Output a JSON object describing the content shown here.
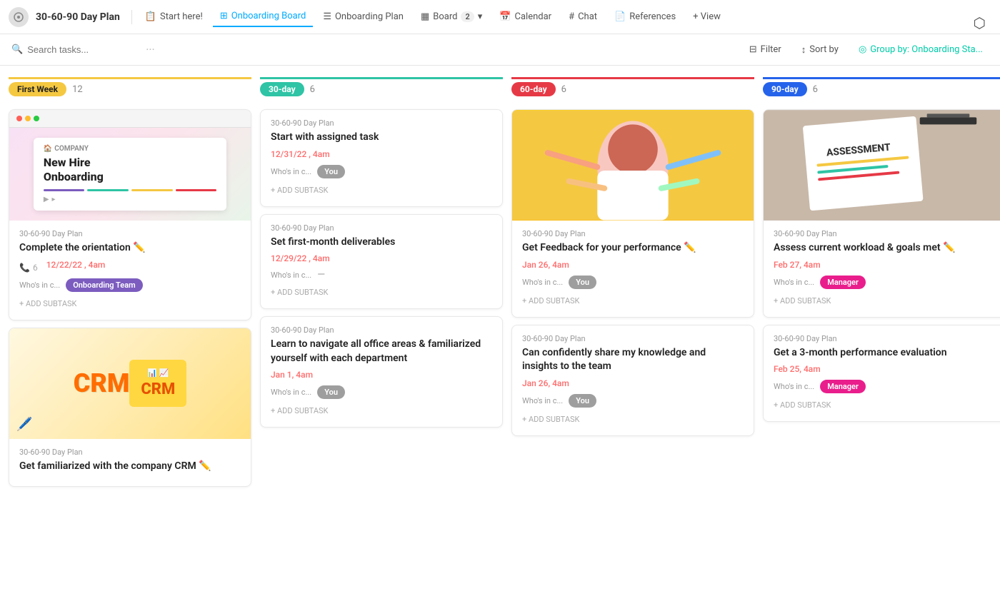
{
  "app": {
    "title": "30-60-90 Day Plan",
    "icon": "⚙"
  },
  "nav": {
    "start_here": "Start here!",
    "onboarding_board": "Onboarding Board",
    "onboarding_plan": "Onboarding Plan",
    "board": "Board",
    "board_count": "2",
    "calendar": "Calendar",
    "chat": "Chat",
    "references": "References",
    "plus_view": "+ View"
  },
  "toolbar": {
    "search_placeholder": "Search tasks...",
    "filter": "Filter",
    "sort_by": "Sort by",
    "group_by": "Group by: Onboarding Sta..."
  },
  "columns": [
    {
      "id": "first-week",
      "label": "First Week",
      "count": "12",
      "color": "#f5c842",
      "badge_class": "badge-first-week",
      "col_class": "col-first-week"
    },
    {
      "id": "30-day",
      "label": "30-day",
      "count": "6",
      "color": "#2ec4a5",
      "badge_class": "badge-30day",
      "col_class": "col-30day"
    },
    {
      "id": "60-day",
      "label": "60-day",
      "count": "6",
      "color": "#e63946",
      "badge_class": "badge-60day",
      "col_class": "col-60day"
    },
    {
      "id": "90-day",
      "label": "90-day",
      "count": "6",
      "color": "#2563eb",
      "badge_class": "badge-90day",
      "col_class": "col-90day"
    }
  ],
  "cards": {
    "first_week": [
      {
        "id": "fw1",
        "project": "30-60-90 Day Plan",
        "title": "Complete the orientation",
        "has_attachment": true,
        "subtask_count": "6",
        "date": "12/22/22 , 4am",
        "whos_in": "Onboarding Team",
        "whos_label": "Who's in c...",
        "assignee_class": "badge-onboarding",
        "type": "browser-card"
      },
      {
        "id": "fw2",
        "project": "30-60-90 Day Plan",
        "title": "Get familiarized with the company CRM",
        "has_attachment": true,
        "type": "crm-card"
      }
    ],
    "thirty_day": [
      {
        "id": "td1",
        "project": "30-60-90 Day Plan",
        "title": "Start with assigned task",
        "date": "12/31/22 , 4am",
        "whos_label": "Who's in c...",
        "whos_in": "You",
        "assignee_class": "badge-you",
        "add_subtask": "+ ADD SUBTASK"
      },
      {
        "id": "td2",
        "project": "30-60-90 Day Plan",
        "title": "Set first-month deliverables",
        "date": "12/29/22 , 4am",
        "whos_label": "Who's in c...",
        "whos_in": "—",
        "assignee_class": "",
        "add_subtask": "+ ADD SUBTASK"
      },
      {
        "id": "td3",
        "project": "30-60-90 Day Plan",
        "title": "Learn to navigate all office areas & familiarized yourself with each department",
        "date": "Jan 1, 4am",
        "whos_label": "Who's in c...",
        "whos_in": "You",
        "assignee_class": "badge-you",
        "add_subtask": "+ ADD SUBTASK"
      }
    ],
    "sixty_day": [
      {
        "id": "sd1",
        "project": "30-60-90 Day Plan",
        "title": "Get Feedback for your performance",
        "has_attachment": true,
        "date": "Jan 26, 4am",
        "whos_label": "Who's in c...",
        "whos_in": "You",
        "assignee_class": "badge-you",
        "add_subtask": "+ ADD SUBTASK",
        "type": "person-card"
      },
      {
        "id": "sd2",
        "project": "30-60-90 Day Plan",
        "title": "Can confidently share my knowledge and insights to the team",
        "date": "Jan 26, 4am",
        "whos_label": "Who's in c...",
        "whos_in": "You",
        "assignee_class": "badge-you",
        "add_subtask": "+ ADD SUBTASK"
      }
    ],
    "ninety_day": [
      {
        "id": "nd1",
        "project": "30-60-90 Day Plan",
        "title": "Assess current workload & goals met",
        "has_attachment": true,
        "date": "Feb 27, 4am",
        "whos_label": "Who's in c...",
        "whos_in": "Manager",
        "assignee_class": "badge-manager",
        "add_subtask": "+ ADD SUBTASK",
        "type": "assessment-card"
      },
      {
        "id": "nd2",
        "project": "30-60-90 Day Plan",
        "title": "Get a 3-month performance evaluation",
        "date": "Feb 25, 4am",
        "whos_label": "Who's in c...",
        "whos_in": "Manager",
        "assignee_class": "badge-manager",
        "add_subtask": "+ ADD SUBTASK"
      }
    ]
  },
  "labels": {
    "whos_in_c": "Who's in c...",
    "add_subtask": "+ ADD SUBTASK",
    "you": "You",
    "manager": "Manager",
    "onboarding_team": "Onboarding Team"
  }
}
